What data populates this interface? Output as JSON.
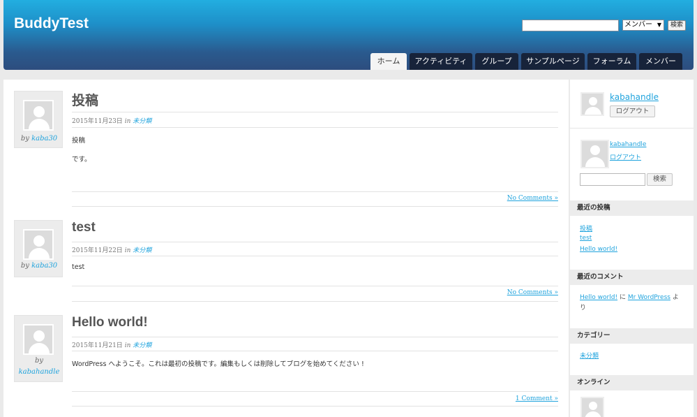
{
  "site": {
    "title": "BuddyTest"
  },
  "search": {
    "placeholder": "",
    "select_value": "メンバー",
    "button_label": "検索"
  },
  "nav": [
    {
      "label": "ホーム",
      "active": true
    },
    {
      "label": "アクティビティ"
    },
    {
      "label": "グループ"
    },
    {
      "label": "サンプルページ"
    },
    {
      "label": "フォーラム"
    },
    {
      "label": "メンバー"
    }
  ],
  "posts": [
    {
      "title": "投稿",
      "author_prefix": "by",
      "author": "kaba30",
      "date": "2015年11月23日",
      "in_label": "in",
      "category": "未分類",
      "body": [
        "投稿",
        "です。"
      ],
      "comments": "No Comments »"
    },
    {
      "title": "test",
      "author_prefix": "by",
      "author": "kaba30",
      "date": "2015年11月22日",
      "in_label": "in",
      "category": "未分類",
      "body": [
        "test"
      ],
      "comments": "No Comments »"
    },
    {
      "title": "Hello world!",
      "author_prefix": "by",
      "author": "kabahandle",
      "date": "2015年11月21日",
      "in_label": "in",
      "category": "未分類",
      "body": [
        "WordPress へようこそ。これは最初の投稿です。編集もしくは削除してブログを始めてください !"
      ],
      "comments": "1 Comment »"
    }
  ],
  "sidebar": {
    "user_name": "kabahandle",
    "logout_button": "ログアウト",
    "widget_user_name": "kabahandle",
    "widget_logout": "ログアウト",
    "search_button": "検索",
    "recent_posts_title": "最近の投稿",
    "recent_posts": [
      "投稿",
      "test",
      "Hello world!"
    ],
    "recent_comments_title": "最近のコメント",
    "recent_comment": {
      "post": "Hello world!",
      "mid": "に",
      "author": "Mr WordPress",
      "suffix": "よ",
      "suffix2": "り"
    },
    "categories_title": "カテゴリー",
    "categories": [
      "未分類"
    ],
    "online_title": "オンライン"
  }
}
